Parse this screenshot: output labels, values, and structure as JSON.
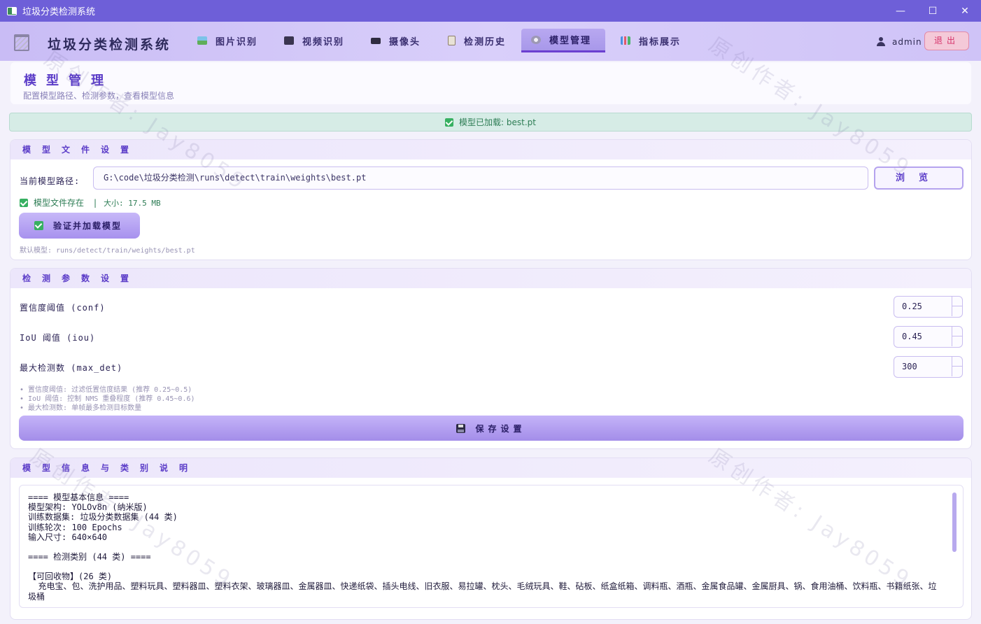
{
  "window": {
    "title": "垃圾分类检测系统",
    "minimize": "—",
    "maximize": "☐",
    "close": "✕"
  },
  "header": {
    "app_title": "垃圾分类检测系统",
    "tabs": [
      {
        "label": "图片识别",
        "icon": "image-icon"
      },
      {
        "label": "视频识别",
        "icon": "film-icon"
      },
      {
        "label": "摄像头",
        "icon": "camera-icon"
      },
      {
        "label": "检测历史",
        "icon": "clipboard-icon"
      },
      {
        "label": "模型管理",
        "icon": "gear-icon",
        "active": true
      },
      {
        "label": "指标展示",
        "icon": "bar-chart-icon"
      }
    ],
    "username": "admin",
    "logout_label": "退出"
  },
  "page": {
    "title": "模型管理",
    "subtitle": "配置模型路径、检测参数，查看模型信息"
  },
  "status": {
    "text": "模型已加载: best.pt"
  },
  "model_file": {
    "heading": "模型文件设置",
    "path_label": "当前模型路径:",
    "path_value": "G:\\code\\垃圾分类检测\\runs\\detect\\train\\weights\\best.pt",
    "browse_label": "浏览",
    "exists_text": "模型文件存在",
    "size_text": "大小: 17.5 MB",
    "verify_label": "验证并加载模型",
    "default_hint": "默认模型: runs/detect/train/weights/best.pt"
  },
  "params": {
    "heading": "检测参数设置",
    "conf_label": "置信度阈值 (conf)",
    "conf_value": "0.25",
    "iou_label": "IoU 阈值 (iou)",
    "iou_value": "0.45",
    "maxdet_label": "最大检测数 (max_det)",
    "maxdet_value": "300",
    "hints": [
      "• 置信度阈值: 过滤低置信度结果 (推荐 0.25~0.5)",
      "• IoU 阈值: 控制 NMS 重叠程度 (推荐 0.45~0.6)",
      "• 最大检测数: 单帧最多检测目标数量"
    ],
    "save_label": "保存设置"
  },
  "info": {
    "heading": "模型信息与类别说明",
    "lines": [
      "==== 模型基本信息 ====",
      "模型架构: YOLOv8n (纳米版)",
      "训练数据集: 垃圾分类数据集 (44 类)",
      "训练轮次: 100 Epochs",
      "输入尺寸: 640×640",
      "",
      "==== 检测类别 (44 类) ====",
      "",
      "【可回收物】(26 类)",
      "  充电宝、包、洗护用品、塑料玩具、塑料器皿、塑料衣架、玻璃器皿、金属器皿、快递纸袋、插头电线、旧衣服、易拉罐、枕头、毛绒玩具、鞋、砧板、纸盒纸箱、调料瓶、酒瓶、金属食品罐、金属厨具、锅、食用油桶、饮料瓶、书籍纸张、垃圾桶"
    ]
  },
  "watermark": "原创作者: Jay8059"
}
